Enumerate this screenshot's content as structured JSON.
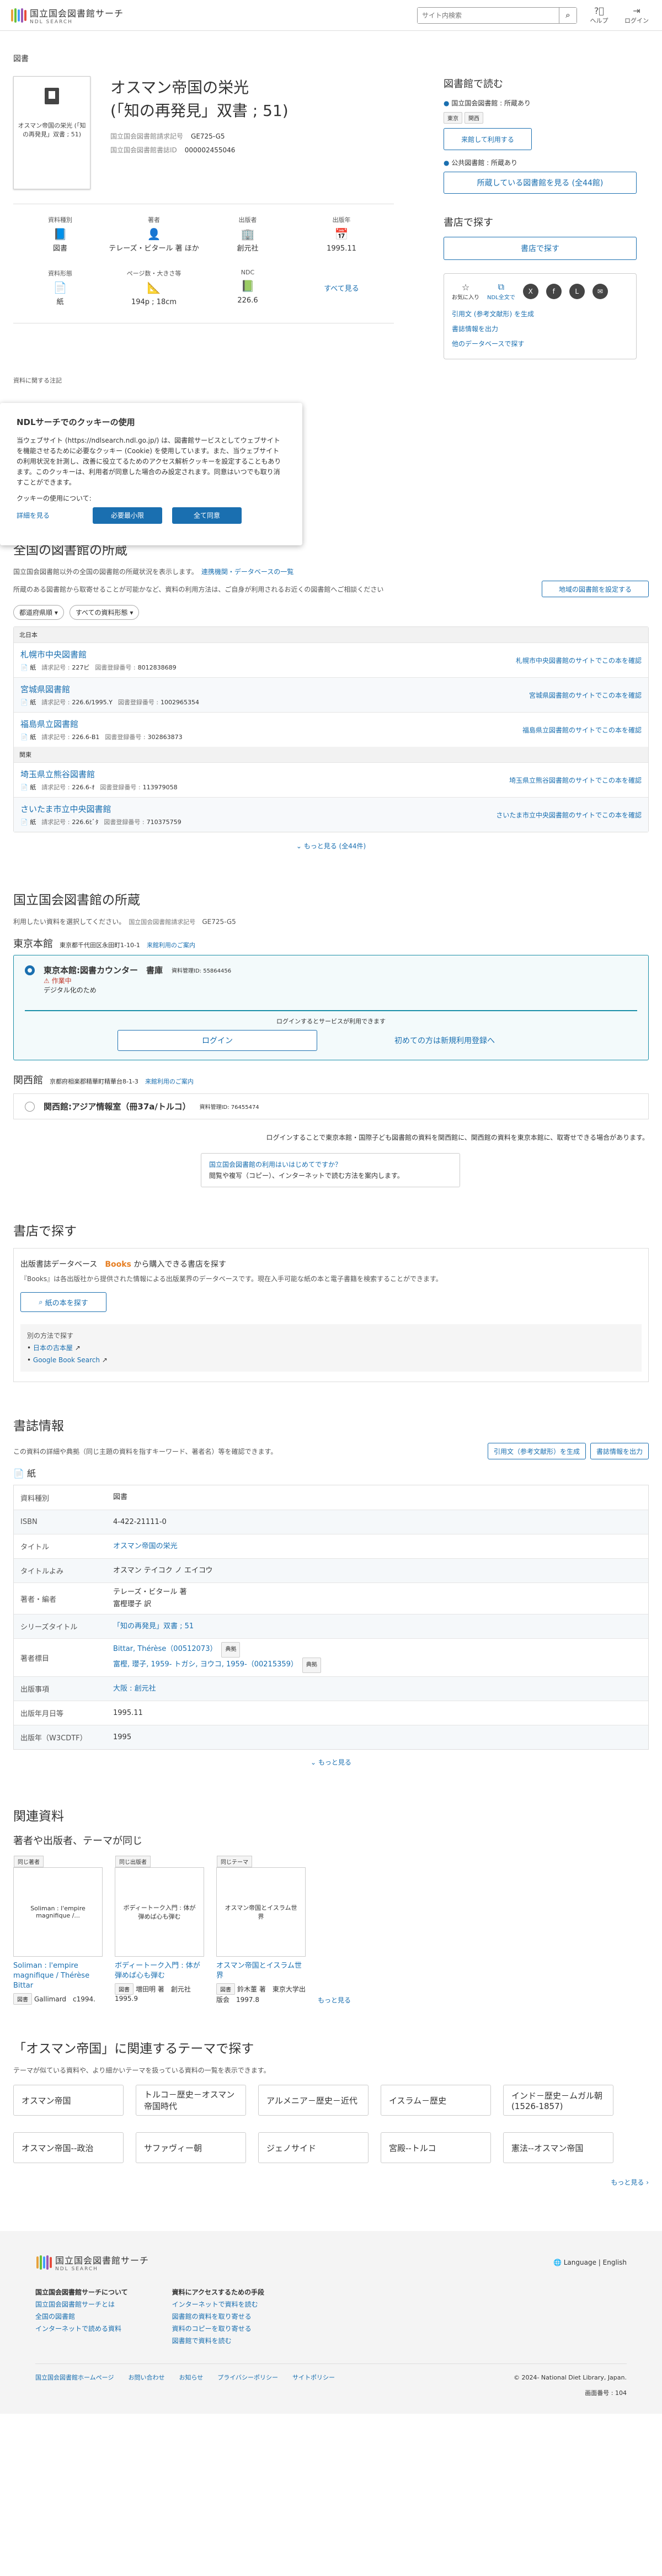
{
  "header": {
    "logo_jp": "国立国会図書館サーチ",
    "logo_en": "NDL SEARCH",
    "search_placeholder": "サイト内検索",
    "help": "ヘルプ",
    "login": "ログイン"
  },
  "breadcrumb": "図書",
  "item": {
    "thumb_text": "オスマン帝国の栄光 (「知の再発見」双書 ; 51)",
    "title_line1": "オスマン帝国の栄光",
    "title_line2": "(「知の再発見」双書 ; 51)",
    "callno_k": "国立国会図書館請求記号",
    "callno": "GE725-G5",
    "bibno_k": "国立国会図書館書誌ID",
    "bibno": "000002455046"
  },
  "attrs": [
    {
      "label": "資料種別",
      "icon": "📘",
      "value": "図書"
    },
    {
      "label": "著者",
      "icon": "👤",
      "value": "テレーズ・ビタール 著 ほか"
    },
    {
      "label": "出版者",
      "icon": "🏢",
      "value": "創元社"
    },
    {
      "label": "出版年",
      "icon": "📅",
      "value": "1995.11"
    },
    {
      "label": "資料形態",
      "icon": "📄",
      "value": "紙"
    },
    {
      "label": "ページ数・大きさ等",
      "icon": "📐",
      "value": "194p ; 18cm"
    },
    {
      "label": "NDC",
      "icon": "📗",
      "value": "226.6"
    }
  ],
  "see_all": "すべて見る",
  "right": {
    "read_h": "図書館で読む",
    "ndl_own": "国立国会図書館 : 所蔵あり",
    "tag1": "東京",
    "tag2": "関西",
    "use_btn": "来館して利用する",
    "pub_own": "公共図書館 : 所蔵あり",
    "libs_btn": "所蔵している図書館を見る (全44館)",
    "shop_h": "書店で探す",
    "shop_btn": "書店で探す",
    "share1": "お気に入り",
    "share2": "NDL全文で",
    "links": [
      "引用文 (参考文献形) を生成",
      "書誌情報を出力",
      "他のデータベースで探す"
    ]
  },
  "cookie": {
    "heading": "NDLサーチでのクッキーの使用",
    "body": "当ウェブサイト (https://ndlsearch.ndl.go.jp/) は、図書館サービスとしてウェブサイトを機能させるために必要なクッキー (Cookie) を使用しています。また、当ウェブサイトの利用状況を計測し、改善に役立てるためのアクセス解析クッキーを設定することもあります。このクッキーは、利用者が同意した場合のみ設定されます。同意はいつでも取り消すことができます。",
    "usage": "クッキーの使用について:",
    "detail": "詳細を見る",
    "btn1": "必要最小限",
    "btn2": "全て同意",
    "partial": "資料に関する注記"
  },
  "allib": {
    "heading": "全国の図書館の所蔵",
    "note1": "国立国会図書館以外の全国の図書館の所蔵状況を表示します。",
    "note_link": "連携機関・データベースの一覧",
    "note2": "所蔵のある図書館から取寄せることが可能かなど、資料の利用方法は、ご自身が利用されるお近くの図書館へご相談ください",
    "set_btn": "地域の図書館を設定する",
    "filter1": "都道府県順",
    "filter2": "すべての資料形態",
    "regions": [
      {
        "name": "北日本",
        "rows": [
          {
            "name": "札幌市中央図書館",
            "form": "紙",
            "callk": "請求記号 :",
            "call": "227ビ",
            "idk": "図書登録番号 :",
            "id": "8012838689",
            "link": "札幌市中央図書館のサイトでこの本を確認"
          },
          {
            "name": "宮城県図書館",
            "form": "紙",
            "callk": "請求記号 :",
            "call": "226.6/1995.Y",
            "idk": "図書登録番号 :",
            "id": "1002965354",
            "link": "宮城県図書館のサイトでこの本を確認"
          },
          {
            "name": "福島県立図書館",
            "form": "紙",
            "callk": "請求記号 :",
            "call": "226.6-B1",
            "idk": "図書登録番号 :",
            "id": "302863873",
            "link": "福島県立図書館のサイトでこの本を確認"
          }
        ]
      },
      {
        "name": "関東",
        "rows": [
          {
            "name": "埼玉県立熊谷図書館",
            "form": "紙",
            "callk": "請求記号 :",
            "call": "226.6-ｵ",
            "idk": "図書登録番号 :",
            "id": "113979058",
            "link": "埼玉県立熊谷図書館のサイトでこの本を確認"
          },
          {
            "name": "さいたま市立中央図書館",
            "form": "紙",
            "callk": "請求記号 :",
            "call": "226.6ﾋﾞﾀ",
            "idk": "図書登録番号 :",
            "id": "710375759",
            "link": "さいたま市立中央図書館のサイトでこの本を確認"
          }
        ]
      }
    ],
    "more": "もっと見る (全44件)"
  },
  "ndl": {
    "heading": "国立国会図書館の所蔵",
    "note": "利用したい資料を選択してください。",
    "callk": "国立国会図書館請求記号",
    "call": "GE725-G5",
    "tokyo": "東京本館",
    "tokyo_addr": "東京都千代田区永田町1-10-1",
    "guide": "来館利用のご案内",
    "counter": "東京本館:図書カウンター　書庫",
    "idk": "資料管理ID: 55864456",
    "status": "作業中",
    "digital": "デジタル化のため",
    "login_note": "ログインするとサービスが利用できます",
    "login_btn": "ログイン",
    "reg_link": "初めての方は新規利用登録へ",
    "kansai": "関西館",
    "kansai_addr": "京都府相楽郡精華町精華台8-1-3",
    "kansai_counter": "関西館:アジア情報室（冊37a/トルコ）",
    "kansai_id": "資料管理ID: 76455474",
    "notice": "ログインすることで東京本館・国際子ども図書館の資料を関西館に、関西館の資料を東京本館に、取寄せできる場合があります。",
    "info_h": "国立国会図書館の利用はいはじめてですか？",
    "info_t": "閲覧や複写（コピー）、インターネットで読む方法を案内します。"
  },
  "shop": {
    "heading": "書店で探す",
    "db": "出版書誌データベース",
    "books": "Books",
    "from": "から購入できる書店を探す",
    "note": "『Books』は各出版社から提供された情報による出版業界のデータベースです。現在入手可能な紙の本と電子書籍を検索することができます。",
    "btn": "紙の本を探す",
    "other": "別の方法で探す",
    "l1": "日本の古本屋",
    "l2": "Google Book Search"
  },
  "bib": {
    "heading": "書誌情報",
    "note": "この資料の詳細や典拠（同じ主題の資料を指すキーワード、著者名）等を確認できます。",
    "cite": "引用文（参考文献形）を生成",
    "out": "書誌情報を出力",
    "form": "紙",
    "rows": [
      {
        "k": "資料種別",
        "v": "図書"
      },
      {
        "k": "ISBN",
        "v": "4-422-21111-0"
      },
      {
        "k": "タイトル",
        "v": "オスマン帝国の栄光",
        "link": true
      },
      {
        "k": "タイトルよみ",
        "v": "オスマン テイコク ノ エイコウ"
      },
      {
        "k": "著者・編者",
        "v": "テレーズ・ビタール 著",
        "v2": "富樫瓔子 訳"
      },
      {
        "k": "シリーズタイトル",
        "v": "「知の再発見」双書 ; 51",
        "link": true
      },
      {
        "k": "著者標目",
        "v": "Bittar, Thérèse（00512073）",
        "v2": "富樫, 瓔子, 1959- トガシ, ヨウコ, 1959-（00215359）",
        "link": true,
        "tag": "典拠"
      },
      {
        "k": "出版事項",
        "v": "大阪 : 創元社",
        "link": true
      },
      {
        "k": "出版年月日等",
        "v": "1995.11"
      },
      {
        "k": "出版年（W3CDTF）",
        "v": "1995"
      }
    ],
    "more": "もっと見る"
  },
  "related": {
    "heading": "関連資料",
    "sub": "著者や出版者、テーマが同じ",
    "cards": [
      {
        "tag": "同じ著者",
        "img": "Soliman : l'empire magnifique /...",
        "title": "Soliman : l'empire magnifique / Thérèse Bittar",
        "badge": "図書",
        "meta": "Gallimard　c1994."
      },
      {
        "tag": "同じ出版者",
        "img": "ボディートーク入門 : 体が弾めば心も弾む",
        "title": "ボディートーク入門 : 体が弾めば心も弾む",
        "badge": "図書",
        "meta": "増田明 著　創元社　1995.9"
      },
      {
        "tag": "同じテーマ",
        "img": "オスマン帝国とイスラム世界",
        "title": "オスマン帝国とイスラム世界",
        "badge": "図書",
        "meta": "鈴木董 著　東京大学出版会　1997.8"
      }
    ],
    "more": "もっと見る"
  },
  "themes": {
    "heading": "「オスマン帝国」に関連するテーマで探す",
    "note": "テーマが似ている資料や、より細かいテーマを扱っている資料の一覧を表示できます。",
    "items": [
      "オスマン帝国",
      "トルコ－歴史－オスマン帝国時代",
      "アルメニア－歴史－近代",
      "イスラム－歴史",
      "インド－歴史－ムガル朝 (1526-1857)",
      "オスマン帝国--政治",
      "サファヴィー朝",
      "ジェノサイド",
      "宮殿--トルコ",
      "憲法--オスマン帝国"
    ],
    "more": "もっと見る"
  },
  "footer": {
    "logo_jp": "国立国会図書館サーチ",
    "logo_en": "NDL SEARCH",
    "lang": "Language",
    "en": "English",
    "c1h": "国立国会図書館サーチについて",
    "c1": [
      "国立国会図書館サーチとは",
      "全国の図書館",
      "インターネットで読める資料"
    ],
    "c2h": "資料にアクセスするための手段",
    "c2": [
      "インターネットで資料を読む",
      "図書館の資料を取り寄せる",
      "資料のコピーを取り寄せる",
      "図書館で資料を読む"
    ],
    "bottom": [
      "国立国会図書館ホームページ",
      "お問い合わせ",
      "お知らせ",
      "プライバシーポリシー",
      "サイトポリシー"
    ],
    "copy": "© 2024- National Diet Library, Japan.",
    "count_k": "画面番号 :",
    "count": "104"
  },
  "colors": {
    "accent": "#1a6fb0",
    "teal": "#1a8fa8"
  }
}
